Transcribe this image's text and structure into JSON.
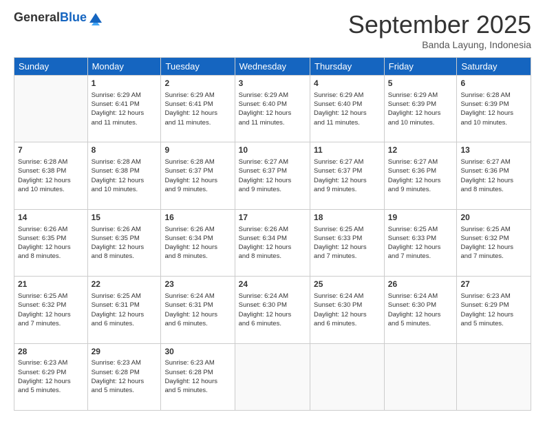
{
  "header": {
    "logo_general": "General",
    "logo_blue": "Blue",
    "month_title": "September 2025",
    "location": "Banda Layung, Indonesia"
  },
  "columns": [
    "Sunday",
    "Monday",
    "Tuesday",
    "Wednesday",
    "Thursday",
    "Friday",
    "Saturday"
  ],
  "weeks": [
    [
      {
        "day": "",
        "info": ""
      },
      {
        "day": "1",
        "info": "Sunrise: 6:29 AM\nSunset: 6:41 PM\nDaylight: 12 hours\nand 11 minutes."
      },
      {
        "day": "2",
        "info": "Sunrise: 6:29 AM\nSunset: 6:41 PM\nDaylight: 12 hours\nand 11 minutes."
      },
      {
        "day": "3",
        "info": "Sunrise: 6:29 AM\nSunset: 6:40 PM\nDaylight: 12 hours\nand 11 minutes."
      },
      {
        "day": "4",
        "info": "Sunrise: 6:29 AM\nSunset: 6:40 PM\nDaylight: 12 hours\nand 11 minutes."
      },
      {
        "day": "5",
        "info": "Sunrise: 6:29 AM\nSunset: 6:39 PM\nDaylight: 12 hours\nand 10 minutes."
      },
      {
        "day": "6",
        "info": "Sunrise: 6:28 AM\nSunset: 6:39 PM\nDaylight: 12 hours\nand 10 minutes."
      }
    ],
    [
      {
        "day": "7",
        "info": "Sunrise: 6:28 AM\nSunset: 6:38 PM\nDaylight: 12 hours\nand 10 minutes."
      },
      {
        "day": "8",
        "info": "Sunrise: 6:28 AM\nSunset: 6:38 PM\nDaylight: 12 hours\nand 10 minutes."
      },
      {
        "day": "9",
        "info": "Sunrise: 6:28 AM\nSunset: 6:37 PM\nDaylight: 12 hours\nand 9 minutes."
      },
      {
        "day": "10",
        "info": "Sunrise: 6:27 AM\nSunset: 6:37 PM\nDaylight: 12 hours\nand 9 minutes."
      },
      {
        "day": "11",
        "info": "Sunrise: 6:27 AM\nSunset: 6:37 PM\nDaylight: 12 hours\nand 9 minutes."
      },
      {
        "day": "12",
        "info": "Sunrise: 6:27 AM\nSunset: 6:36 PM\nDaylight: 12 hours\nand 9 minutes."
      },
      {
        "day": "13",
        "info": "Sunrise: 6:27 AM\nSunset: 6:36 PM\nDaylight: 12 hours\nand 8 minutes."
      }
    ],
    [
      {
        "day": "14",
        "info": "Sunrise: 6:26 AM\nSunset: 6:35 PM\nDaylight: 12 hours\nand 8 minutes."
      },
      {
        "day": "15",
        "info": "Sunrise: 6:26 AM\nSunset: 6:35 PM\nDaylight: 12 hours\nand 8 minutes."
      },
      {
        "day": "16",
        "info": "Sunrise: 6:26 AM\nSunset: 6:34 PM\nDaylight: 12 hours\nand 8 minutes."
      },
      {
        "day": "17",
        "info": "Sunrise: 6:26 AM\nSunset: 6:34 PM\nDaylight: 12 hours\nand 8 minutes."
      },
      {
        "day": "18",
        "info": "Sunrise: 6:25 AM\nSunset: 6:33 PM\nDaylight: 12 hours\nand 7 minutes."
      },
      {
        "day": "19",
        "info": "Sunrise: 6:25 AM\nSunset: 6:33 PM\nDaylight: 12 hours\nand 7 minutes."
      },
      {
        "day": "20",
        "info": "Sunrise: 6:25 AM\nSunset: 6:32 PM\nDaylight: 12 hours\nand 7 minutes."
      }
    ],
    [
      {
        "day": "21",
        "info": "Sunrise: 6:25 AM\nSunset: 6:32 PM\nDaylight: 12 hours\nand 7 minutes."
      },
      {
        "day": "22",
        "info": "Sunrise: 6:25 AM\nSunset: 6:31 PM\nDaylight: 12 hours\nand 6 minutes."
      },
      {
        "day": "23",
        "info": "Sunrise: 6:24 AM\nSunset: 6:31 PM\nDaylight: 12 hours\nand 6 minutes."
      },
      {
        "day": "24",
        "info": "Sunrise: 6:24 AM\nSunset: 6:30 PM\nDaylight: 12 hours\nand 6 minutes."
      },
      {
        "day": "25",
        "info": "Sunrise: 6:24 AM\nSunset: 6:30 PM\nDaylight: 12 hours\nand 6 minutes."
      },
      {
        "day": "26",
        "info": "Sunrise: 6:24 AM\nSunset: 6:30 PM\nDaylight: 12 hours\nand 5 minutes."
      },
      {
        "day": "27",
        "info": "Sunrise: 6:23 AM\nSunset: 6:29 PM\nDaylight: 12 hours\nand 5 minutes."
      }
    ],
    [
      {
        "day": "28",
        "info": "Sunrise: 6:23 AM\nSunset: 6:29 PM\nDaylight: 12 hours\nand 5 minutes."
      },
      {
        "day": "29",
        "info": "Sunrise: 6:23 AM\nSunset: 6:28 PM\nDaylight: 12 hours\nand 5 minutes."
      },
      {
        "day": "30",
        "info": "Sunrise: 6:23 AM\nSunset: 6:28 PM\nDaylight: 12 hours\nand 5 minutes."
      },
      {
        "day": "",
        "info": ""
      },
      {
        "day": "",
        "info": ""
      },
      {
        "day": "",
        "info": ""
      },
      {
        "day": "",
        "info": ""
      }
    ]
  ]
}
